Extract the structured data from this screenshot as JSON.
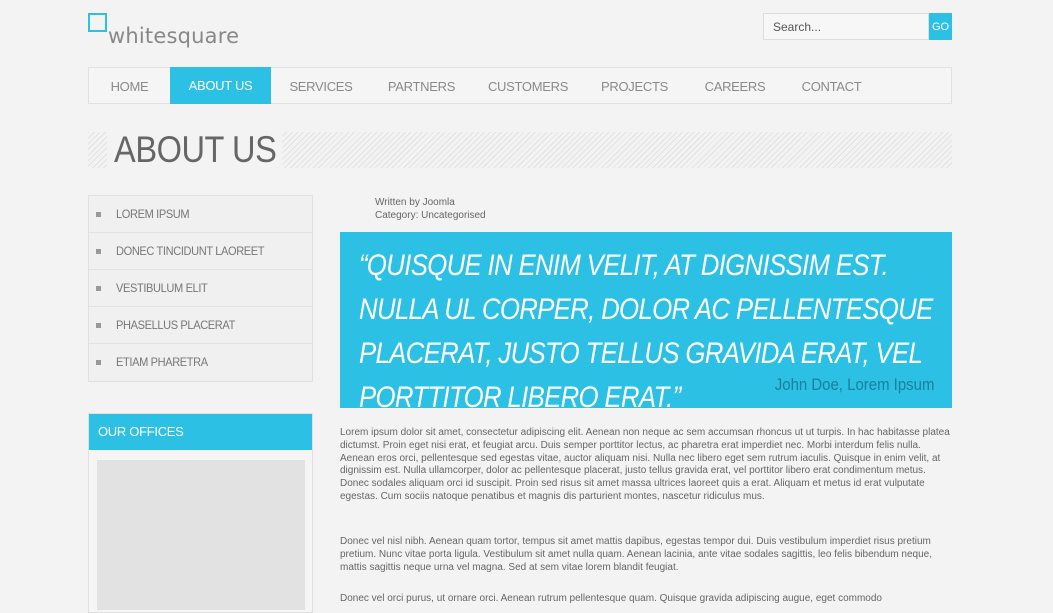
{
  "header": {
    "logo_text": "whitesquare",
    "search_placeholder": "Search...",
    "search_button": "GO"
  },
  "nav": [
    {
      "label": "HOME",
      "active": false
    },
    {
      "label": "ABOUT US",
      "active": true
    },
    {
      "label": "SERVICES",
      "active": false
    },
    {
      "label": "PARTNERS",
      "active": false
    },
    {
      "label": "CUSTOMERS",
      "active": false
    },
    {
      "label": "PROJECTS",
      "active": false
    },
    {
      "label": "CAREERS",
      "active": false
    },
    {
      "label": "CONTACT",
      "active": false
    }
  ],
  "page_title": "ABOUT US",
  "sidebar": {
    "items": [
      {
        "label": "LOREM IPSUM"
      },
      {
        "label": "DONEC TINCIDUNT LAOREET"
      },
      {
        "label": "VESTIBULUM ELIT"
      },
      {
        "label": "PHASELLUS PLACERAT"
      },
      {
        "label": "ETIAM PHARETRA"
      }
    ],
    "offices_title": "OUR OFFICES"
  },
  "article": {
    "written_by": "Written by Joomla",
    "category": "Category: Uncategorised",
    "quote": "“Quisque in enim velit, at dignissim est. nulla ul corper, dolor ac pellentesque placerat, justo tellus gravida erat, vel porttitor libero erat.”",
    "quote_author": "John Doe, Lorem Ipsum",
    "paragraphs": [
      "Lorem ipsum dolor sit amet, consectetur adipiscing elit. Aenean non neque ac sem accumsan rhoncus ut ut turpis. In hac habitasse platea dictumst. Proin eget nisi erat, et feugiat arcu. Duis semper porttitor lectus, ac pharetra erat imperdiet nec. Morbi interdum felis nulla. Aenean eros orci, pellentesque sed egestas vitae, auctor aliquam nisi. Nulla nec libero eget sem rutrum iaculis. Quisque in enim velit, at dignissim est. Nulla ullamcorper, dolor ac pellentesque placerat, justo tellus gravida erat, vel porttitor libero erat condimentum metus. Donec sodales aliquam orci id suscipit. Proin sed risus sit amet massa ultrices laoreet quis a erat. Aliquam et metus id erat vulputate egestas. Cum sociis natoque penatibus et magnis dis parturient montes, nascetur ridiculus mus.",
      "Donec vel nisl nibh. Aenean quam tortor, tempus sit amet mattis dapibus, egestas tempor dui. Duis vestibulum imperdiet risus pretium pretium. Nunc vitae porta ligula. Vestibulum sit amet nulla quam. Aenean lacinia, ante vitae sodales sagittis, leo felis bibendum neque, mattis sagittis neque urna vel magna. Sed at sem vitae lorem blandit feugiat.",
      "Donec vel orci purus, ut ornare orci. Aenean rutrum pellentesque quam. Quisque gravida adipiscing augue, eget commodo"
    ]
  },
  "colors": {
    "accent": "#2bc0e4",
    "background": "#f3f3f3",
    "text": "#666666"
  }
}
